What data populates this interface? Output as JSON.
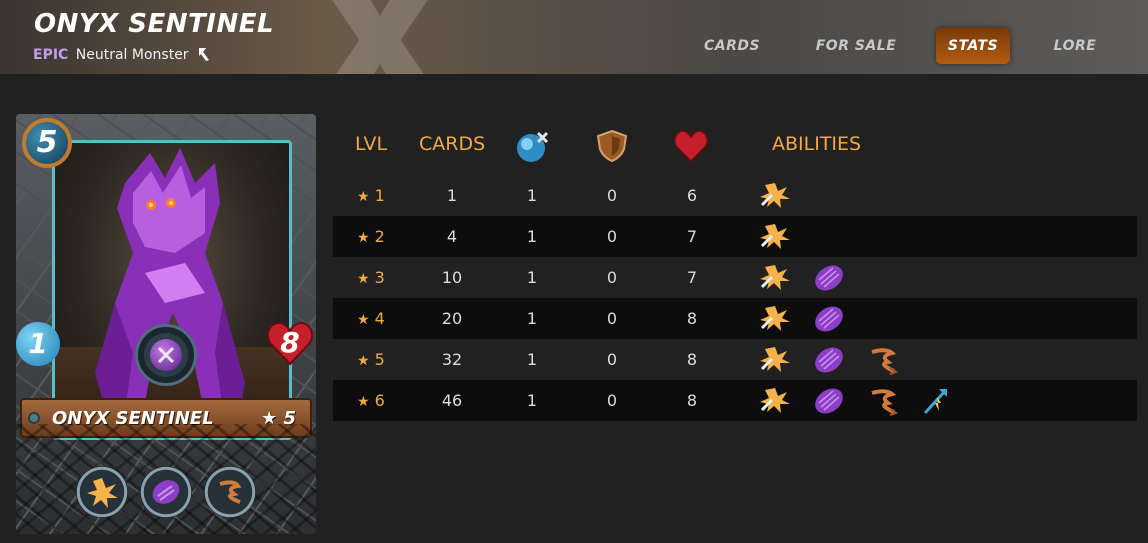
{
  "header": {
    "title": "ONYX SENTINEL",
    "rarity": "EPIC",
    "type_text": "Neutral Monster",
    "tabs": [
      {
        "label": "CARDS",
        "active": false
      },
      {
        "label": "FOR SALE",
        "active": false
      },
      {
        "label": "STATS",
        "active": true
      },
      {
        "label": "LORE",
        "active": false
      }
    ]
  },
  "card": {
    "name": "ONYX SENTINEL",
    "level": "★ 5",
    "mana": "5",
    "attack": "1",
    "health": "8",
    "attack_type": "magic-attack-icon",
    "card_abilities": [
      "blast-icon",
      "void-armor-icon",
      "retaliate-icon"
    ]
  },
  "stats": {
    "headers": {
      "lvl": "LVL",
      "cards": "CARDS",
      "magic_icon": "magic-attack-icon",
      "armor_icon": "armor-icon",
      "health_icon": "health-icon",
      "abilities": "ABILITIES"
    },
    "rows": [
      {
        "lvl": "1",
        "cards": "1",
        "magic": "1",
        "armor": "0",
        "health": "6",
        "abilities": [
          "blast-icon"
        ]
      },
      {
        "lvl": "2",
        "cards": "4",
        "magic": "1",
        "armor": "0",
        "health": "7",
        "abilities": [
          "blast-icon"
        ]
      },
      {
        "lvl": "3",
        "cards": "10",
        "magic": "1",
        "armor": "0",
        "health": "7",
        "abilities": [
          "blast-icon",
          "void-armor-icon"
        ]
      },
      {
        "lvl": "4",
        "cards": "20",
        "magic": "1",
        "armor": "0",
        "health": "8",
        "abilities": [
          "blast-icon",
          "void-armor-icon"
        ]
      },
      {
        "lvl": "5",
        "cards": "32",
        "magic": "1",
        "armor": "0",
        "health": "8",
        "abilities": [
          "blast-icon",
          "void-armor-icon",
          "retaliate-icon"
        ]
      },
      {
        "lvl": "6",
        "cards": "46",
        "magic": "1",
        "armor": "0",
        "health": "8",
        "abilities": [
          "blast-icon",
          "void-armor-icon",
          "retaliate-icon",
          "magic-reflect-icon"
        ]
      }
    ]
  },
  "colors": {
    "accent": "#f3a941",
    "active_tab": "#b15c10",
    "rarity": "#c39cf0",
    "page_bg": "#212121",
    "row_dark": "#0d0d0d"
  }
}
